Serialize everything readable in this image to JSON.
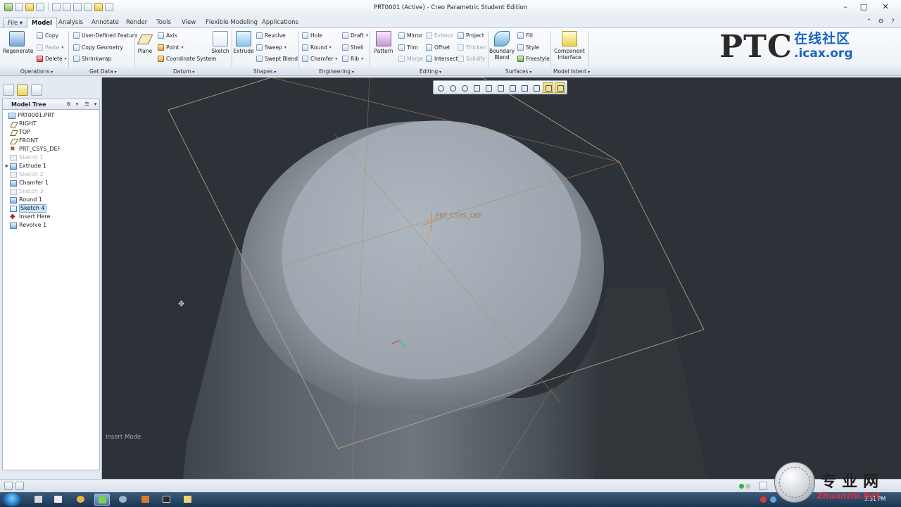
{
  "window": {
    "title": "PRT0001 (Active) - Creo Parametric Student Edition"
  },
  "tabs": [
    {
      "label": "File"
    },
    {
      "label": "Model"
    },
    {
      "label": "Analysis"
    },
    {
      "label": "Annotate"
    },
    {
      "label": "Render"
    },
    {
      "label": "Tools"
    },
    {
      "label": "View"
    },
    {
      "label": "Flexible Modeling"
    },
    {
      "label": "Applications"
    }
  ],
  "active_tab": "Model",
  "ribbon": {
    "operations": {
      "group_label": "Operations",
      "regenerate": "Regenerate",
      "copy": "Copy",
      "paste": "Paste",
      "delete": "Delete"
    },
    "get_data": {
      "group_label": "Get Data",
      "user_defined_feature": "User-Defined Feature",
      "copy_geometry": "Copy Geometry",
      "shrinkwrap": "Shrinkwrap"
    },
    "datum": {
      "group_label": "Datum",
      "plane": "Plane",
      "axis": "Axis",
      "point": "Point",
      "coordinate_system": "Coordinate System",
      "sketch": "Sketch"
    },
    "shapes": {
      "group_label": "Shapes",
      "extrude": "Extrude",
      "revolve": "Revolve",
      "sweep": "Sweep",
      "swept_blend": "Swept Blend"
    },
    "engineering": {
      "group_label": "Engineering",
      "hole": "Hole",
      "round": "Round",
      "chamfer": "Chamfer",
      "draft": "Draft",
      "shell": "Shell",
      "rib": "Rib"
    },
    "editing": {
      "group_label": "Editing",
      "pattern": "Pattern",
      "mirror": "Mirror",
      "trim": "Trim",
      "merge": "Merge",
      "extend": "Extend",
      "offset": "Offset",
      "intersect": "Intersect",
      "project": "Project",
      "thicken": "Thicken",
      "solidify": "Solidify"
    },
    "surfaces": {
      "group_label": "Surfaces",
      "boundary_blend": "Boundary Blend",
      "fill": "Fill",
      "style": "Style",
      "freestyle": "Freestyle"
    },
    "model_intent": {
      "group_label": "Model Intent",
      "component_interface": "Component Interface"
    }
  },
  "logo": {
    "ptc": "PTC",
    "cn": "在线社区",
    "url": ".icax.org"
  },
  "model_tree": {
    "title": "Model Tree",
    "items": [
      {
        "label": "PRT0001.PRT"
      },
      {
        "label": "RIGHT"
      },
      {
        "label": "TOP"
      },
      {
        "label": "FRONT"
      },
      {
        "label": "PRT_CSYS_DEF"
      },
      {
        "label": "Sketch 1"
      },
      {
        "label": "Extrude 1"
      },
      {
        "label": "Sketch 2"
      },
      {
        "label": "Chamfer 1"
      },
      {
        "label": "Sketch 3"
      },
      {
        "label": "Round 1"
      },
      {
        "label": "Sketch 4"
      },
      {
        "label": "Insert Here"
      },
      {
        "label": "Revolve 1"
      }
    ]
  },
  "viewport": {
    "csys_label": "PRT_CSYS_DEF",
    "mode_label": "Insert Mode",
    "background": "#2d3238"
  },
  "taskbar": {
    "clock": "5:31 PM"
  },
  "watermark": {
    "cn": "专业网",
    "url": "Zhuanzhi.Net"
  }
}
